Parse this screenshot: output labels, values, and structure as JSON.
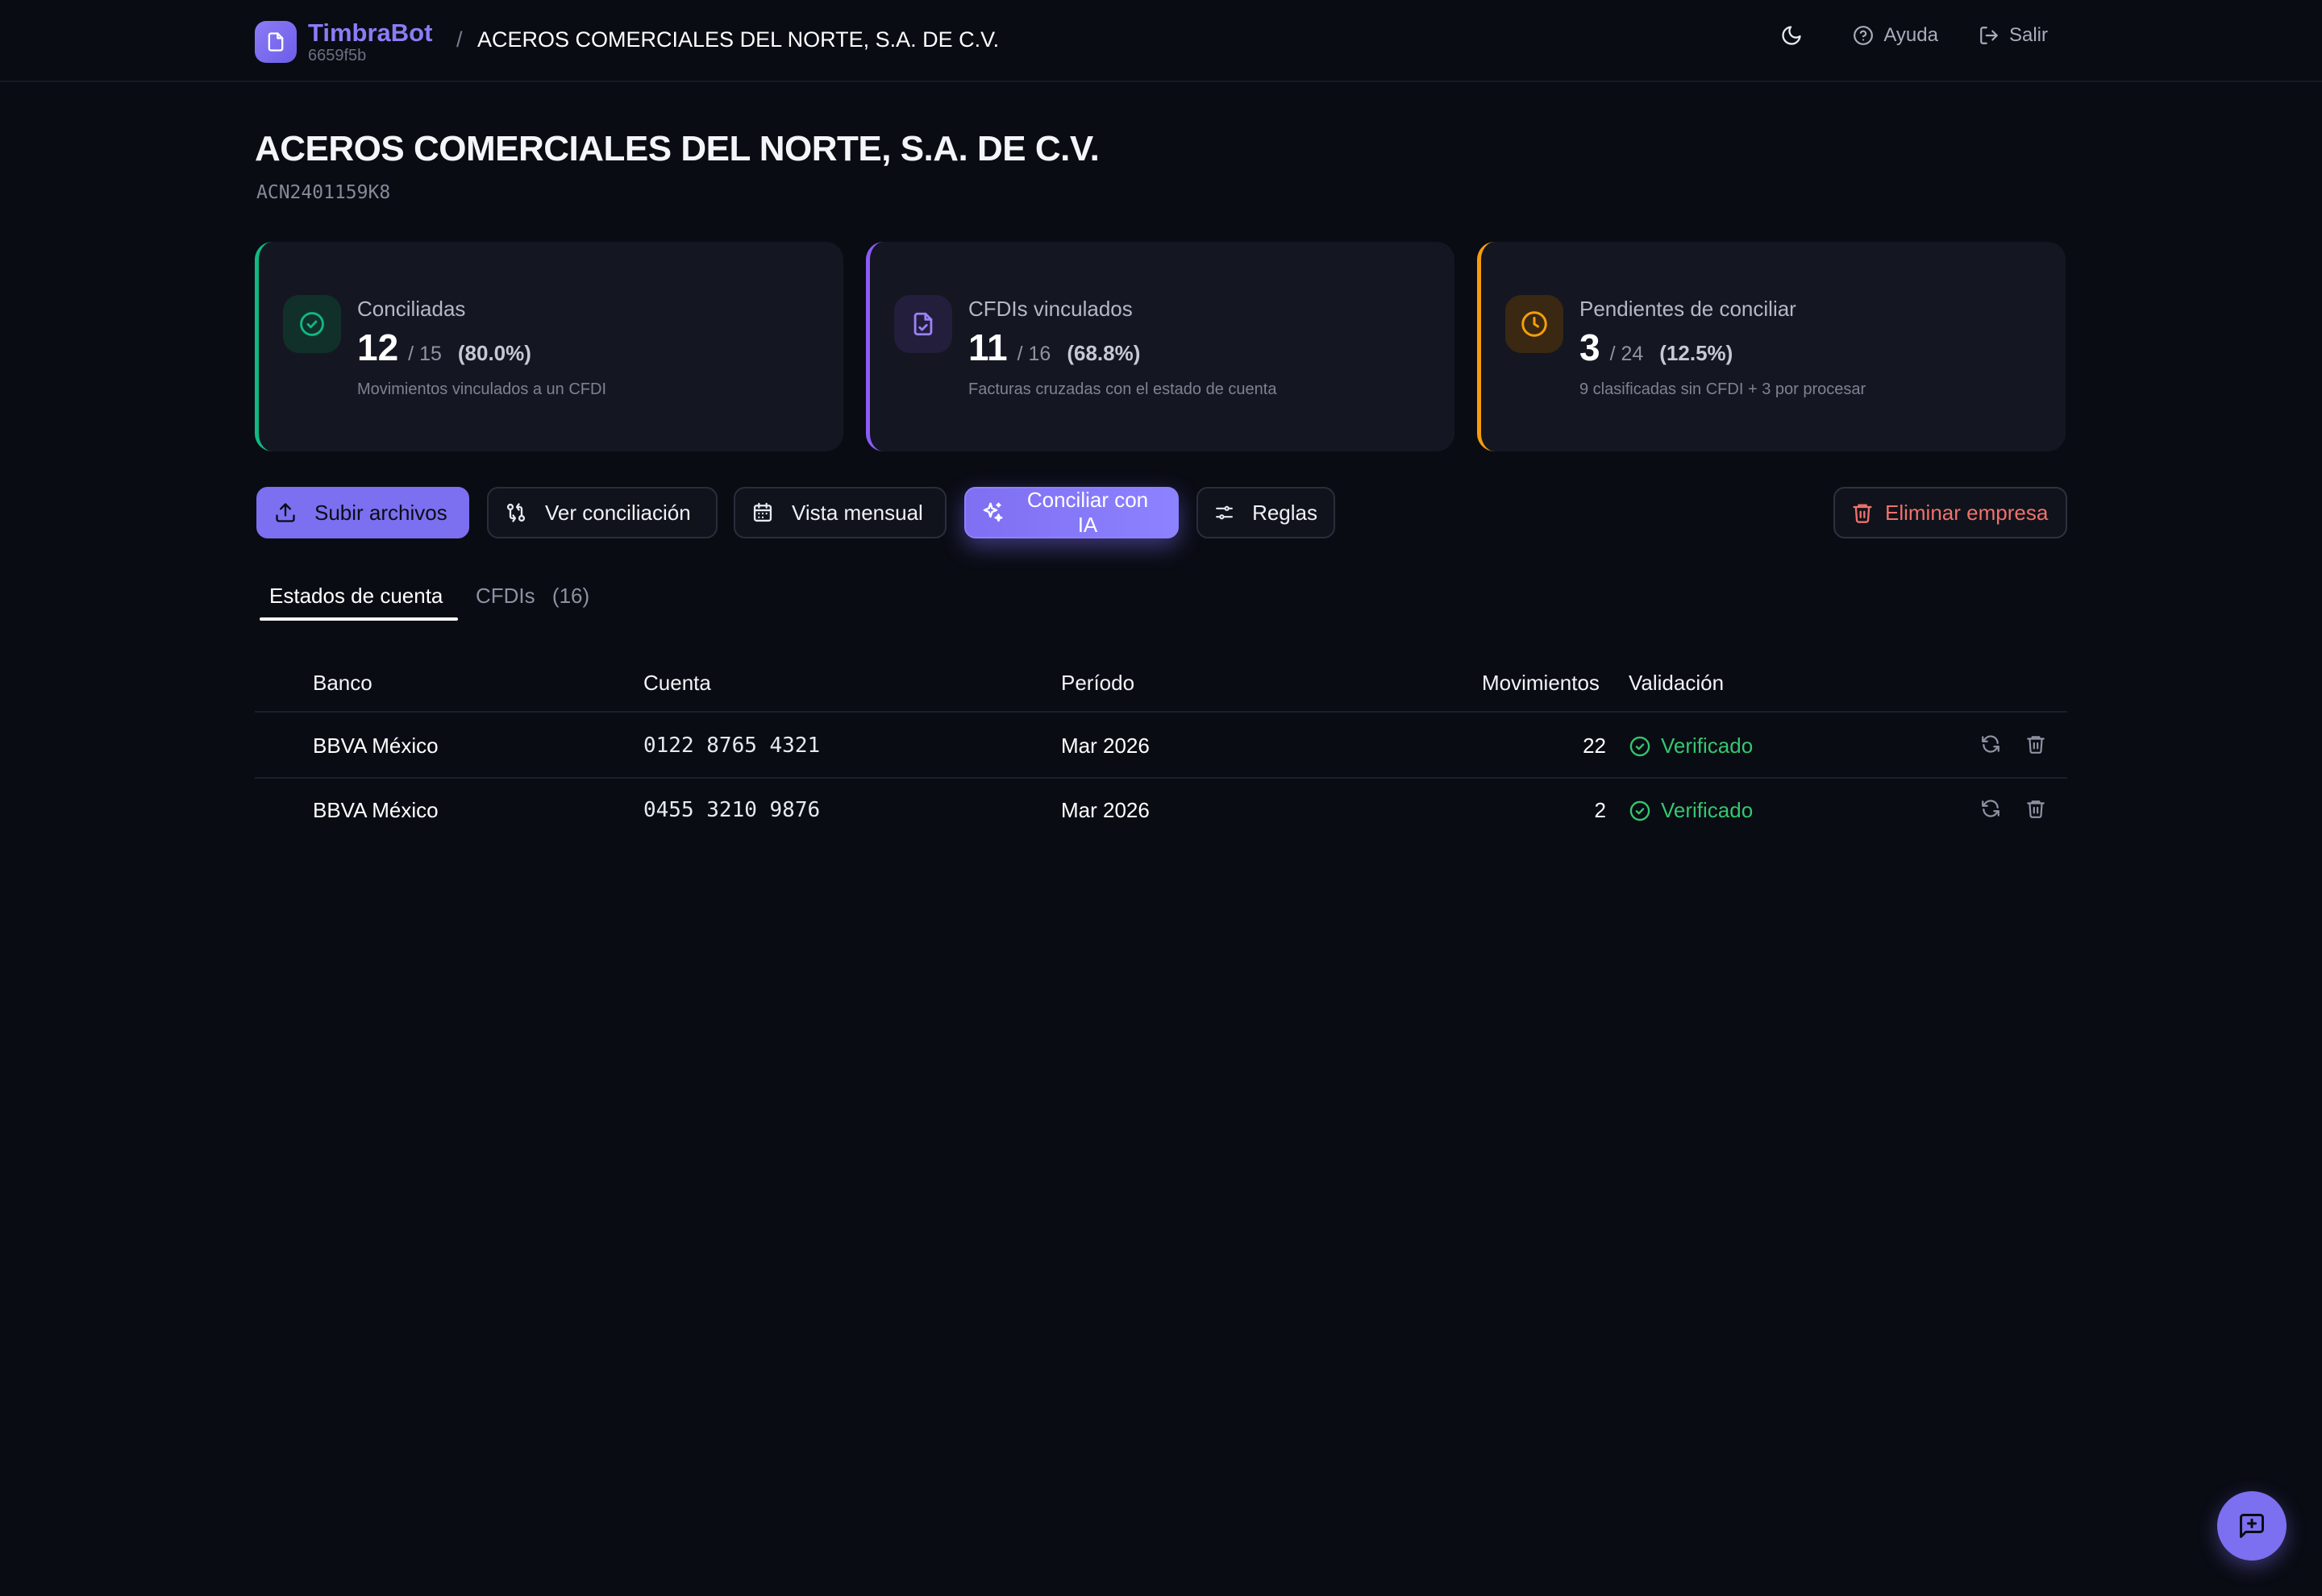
{
  "app": {
    "name": "TimbraBot",
    "instance_id": "6659f5b",
    "breadcrumb_separator": "/",
    "breadcrumb_company": "ACEROS COMERCIALES DEL NORTE, S.A. DE C.V."
  },
  "topbar": {
    "theme_toggle_icon": "moon-icon",
    "help_label": "Ayuda",
    "logout_label": "Salir"
  },
  "company": {
    "name": "ACEROS COMERCIALES DEL NORTE, S.A. DE C.V.",
    "rfc": "ACN2401159K8"
  },
  "stats": [
    {
      "label": "Conciliadas",
      "value": "12",
      "total": "/ 15",
      "percent": "(80.0%)",
      "description": "Movimientos vinculados a un CFDI",
      "accent": "#10b981",
      "icon": "check-circle-icon"
    },
    {
      "label": "CFDIs vinculados",
      "value": "11",
      "total": "/ 16",
      "percent": "(68.8%)",
      "description": "Facturas cruzadas con el estado de cuenta",
      "accent": "#8b5cf6",
      "icon": "file-check-icon"
    },
    {
      "label": "Pendientes de conciliar",
      "value": "3",
      "total": "/ 24",
      "percent": "(12.5%)",
      "description": "9 clasificadas sin CFDI + 3 por procesar",
      "accent": "#f59e0b",
      "icon": "clock-icon"
    }
  ],
  "toolbar": {
    "upload_label": "Subir archivos",
    "reconciliation_label": "Ver conciliación",
    "monthly_label": "Vista mensual",
    "ai_label": "Conciliar con IA",
    "rules_label": "Reglas",
    "delete_label": "Eliminar empresa"
  },
  "tabs": [
    {
      "label": "Estados de cuenta",
      "count": ""
    },
    {
      "label": "CFDIs",
      "count": "(16)"
    }
  ],
  "table": {
    "columns": [
      "Banco",
      "Cuenta",
      "Período",
      "Movimientos",
      "Validación"
    ],
    "rows": [
      {
        "bank": "BBVA México",
        "account": "0122 8765 4321",
        "period": "Mar 2026",
        "movements": "22",
        "validation": "Verificado"
      },
      {
        "bank": "BBVA México",
        "account": "0455 3210 9876",
        "period": "Mar 2026",
        "movements": "2",
        "validation": "Verificado"
      }
    ]
  },
  "colors": {
    "background": "#0a0c14",
    "brand": "#8b7cf6",
    "success": "#34c76f",
    "danger": "#f0716b"
  }
}
